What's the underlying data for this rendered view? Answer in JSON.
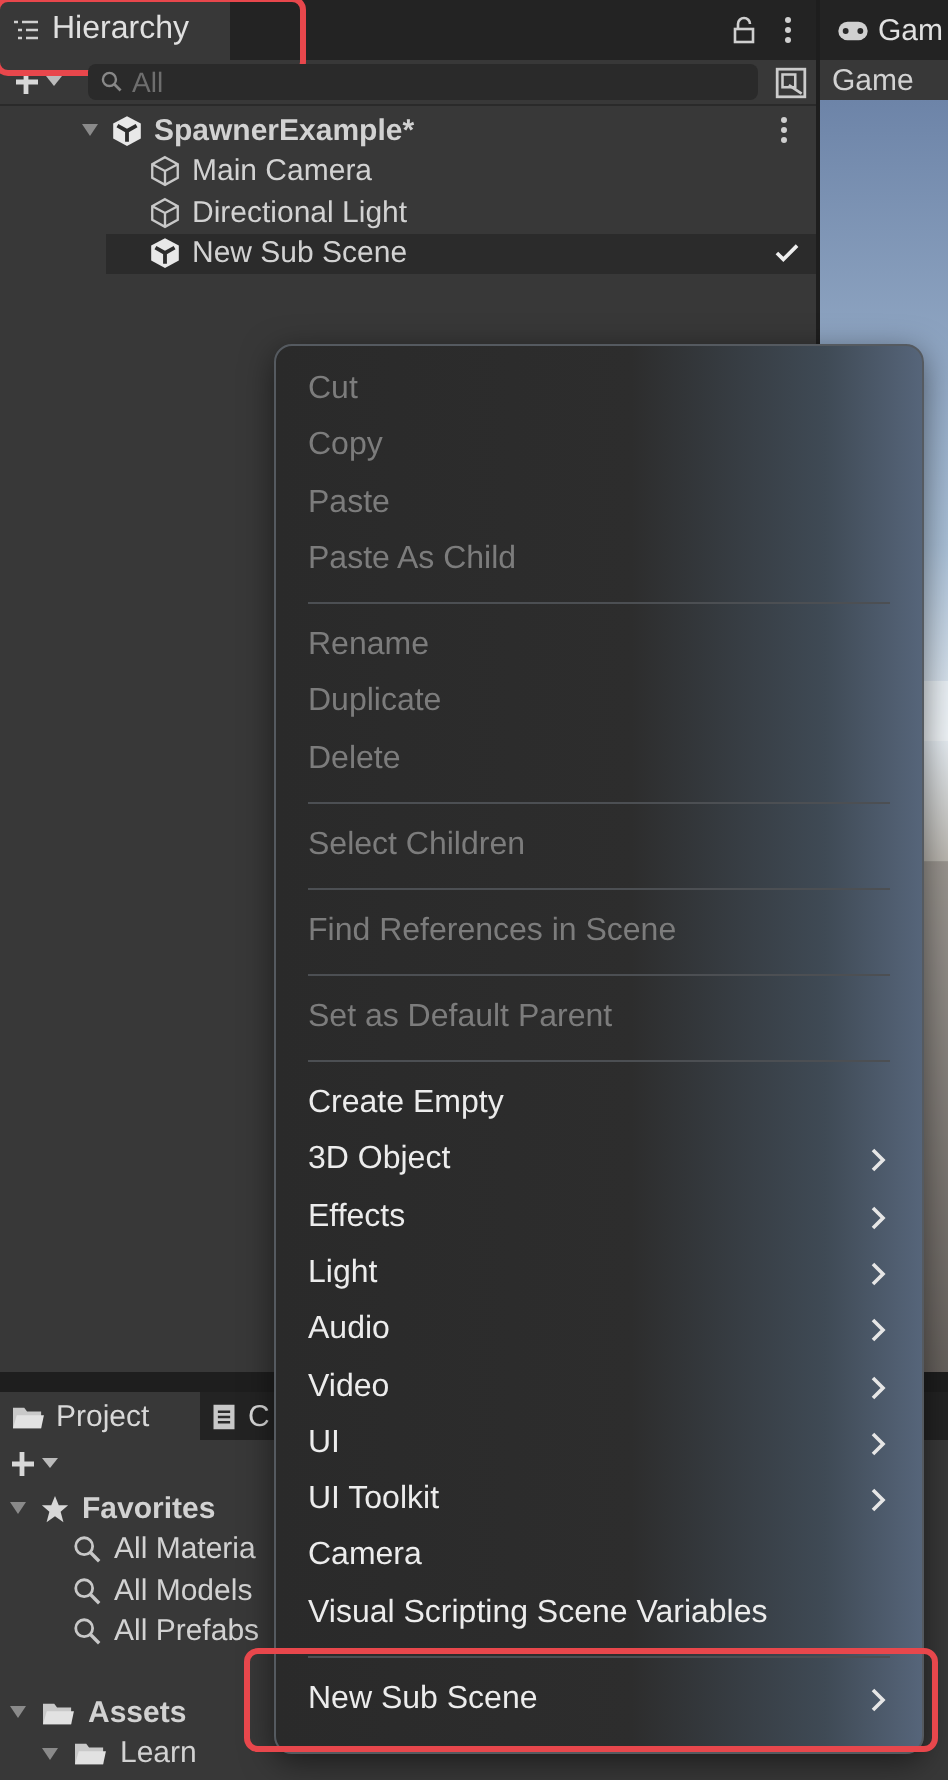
{
  "hierarchy": {
    "tab": {
      "label": "Hierarchy",
      "highlighted": true
    },
    "search": {
      "placeholder": "All"
    },
    "tree": [
      {
        "label": "SpawnerExample*",
        "kind": "scene",
        "expanded": true,
        "selected": false,
        "children": [
          {
            "label": "Main Camera",
            "kind": "gameobject",
            "selected": false,
            "checked": false
          },
          {
            "label": "Directional Light",
            "kind": "gameobject",
            "selected": false,
            "checked": false
          },
          {
            "label": "New Sub Scene",
            "kind": "subscene",
            "selected": true,
            "checked": true
          }
        ]
      }
    ]
  },
  "game": {
    "tab": {
      "label": "Gam"
    },
    "toolbar": {
      "label": "Game"
    }
  },
  "project": {
    "tabs": [
      {
        "label": "Project",
        "kind": "folder",
        "selected": true
      },
      {
        "label": "C",
        "kind": "console",
        "selected": false
      }
    ],
    "tree": [
      {
        "label": "Favorites",
        "kind": "favorites",
        "expanded": true,
        "children": [
          {
            "label": "All Materia",
            "kind": "search"
          },
          {
            "label": "All Models",
            "kind": "search"
          },
          {
            "label": "All Prefabs",
            "kind": "search"
          }
        ]
      },
      {
        "label": "Assets",
        "kind": "folder",
        "expanded": true,
        "children": [
          {
            "label": "Learn",
            "kind": "folder",
            "expanded": true
          }
        ]
      }
    ]
  },
  "context_menu": [
    {
      "kind": "item",
      "label": "Cut",
      "disabled": true,
      "submenu": false,
      "highlighted": false
    },
    {
      "kind": "item",
      "label": "Copy",
      "disabled": true,
      "submenu": false,
      "highlighted": false
    },
    {
      "kind": "item",
      "label": "Paste",
      "disabled": true,
      "submenu": false,
      "highlighted": false
    },
    {
      "kind": "item",
      "label": "Paste As Child",
      "disabled": true,
      "submenu": false,
      "highlighted": false
    },
    {
      "kind": "separator"
    },
    {
      "kind": "item",
      "label": "Rename",
      "disabled": true,
      "submenu": false,
      "highlighted": false
    },
    {
      "kind": "item",
      "label": "Duplicate",
      "disabled": true,
      "submenu": false,
      "highlighted": false
    },
    {
      "kind": "item",
      "label": "Delete",
      "disabled": true,
      "submenu": false,
      "highlighted": false
    },
    {
      "kind": "separator"
    },
    {
      "kind": "item",
      "label": "Select Children",
      "disabled": true,
      "submenu": false,
      "highlighted": false
    },
    {
      "kind": "separator"
    },
    {
      "kind": "item",
      "label": "Find References in Scene",
      "disabled": true,
      "submenu": false,
      "highlighted": false
    },
    {
      "kind": "separator"
    },
    {
      "kind": "item",
      "label": "Set as Default Parent",
      "disabled": true,
      "submenu": false,
      "highlighted": false
    },
    {
      "kind": "separator"
    },
    {
      "kind": "item",
      "label": "Create Empty",
      "disabled": false,
      "submenu": false,
      "highlighted": false
    },
    {
      "kind": "item",
      "label": "3D Object",
      "disabled": false,
      "submenu": true,
      "highlighted": false
    },
    {
      "kind": "item",
      "label": "Effects",
      "disabled": false,
      "submenu": true,
      "highlighted": false
    },
    {
      "kind": "item",
      "label": "Light",
      "disabled": false,
      "submenu": true,
      "highlighted": false
    },
    {
      "kind": "item",
      "label": "Audio",
      "disabled": false,
      "submenu": true,
      "highlighted": false
    },
    {
      "kind": "item",
      "label": "Video",
      "disabled": false,
      "submenu": true,
      "highlighted": false
    },
    {
      "kind": "item",
      "label": "UI",
      "disabled": false,
      "submenu": true,
      "highlighted": false
    },
    {
      "kind": "item",
      "label": "UI Toolkit",
      "disabled": false,
      "submenu": true,
      "highlighted": false
    },
    {
      "kind": "item",
      "label": "Camera",
      "disabled": false,
      "submenu": false,
      "highlighted": false
    },
    {
      "kind": "item",
      "label": "Visual Scripting Scene Variables",
      "disabled": false,
      "submenu": false,
      "highlighted": false
    },
    {
      "kind": "separator"
    },
    {
      "kind": "item",
      "label": "New Sub Scene",
      "disabled": false,
      "submenu": true,
      "highlighted": true
    }
  ]
}
